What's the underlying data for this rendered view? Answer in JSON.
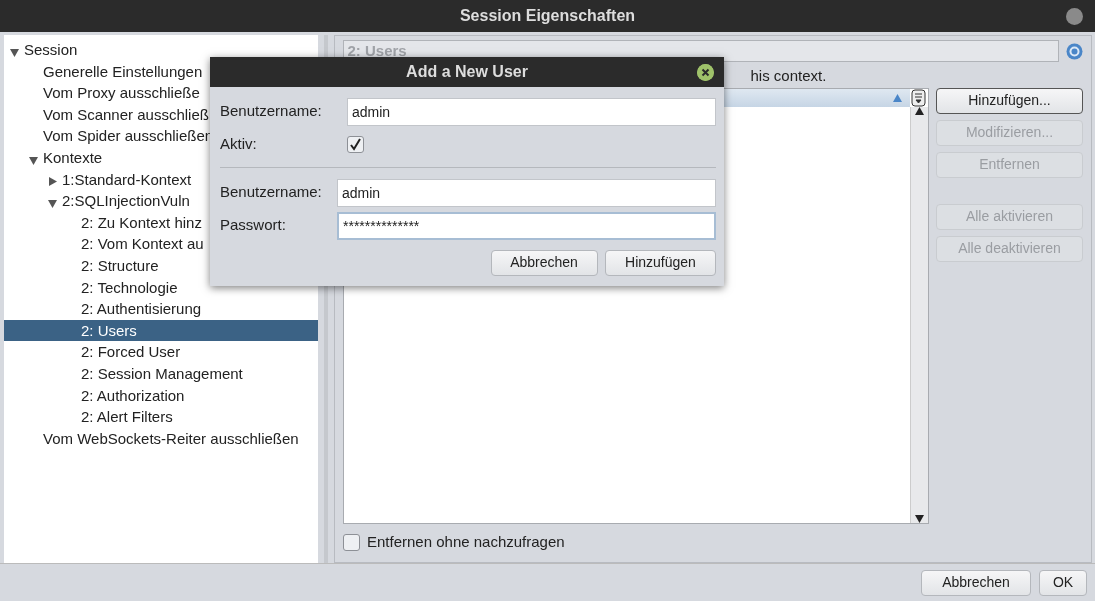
{
  "window": {
    "title": "Session Eigenschaften"
  },
  "tree": [
    {
      "label": "Session",
      "expanded": true,
      "selected": false,
      "children": [
        {
          "label": "Generelle Einstellungen",
          "selected": false
        },
        {
          "label": "Vom Proxy ausschließe",
          "selected": false
        },
        {
          "label": "Vom Scanner ausschließ",
          "selected": false
        },
        {
          "label": "Vom Spider ausschließen",
          "selected": false
        },
        {
          "label": "Kontexte",
          "expanded": true,
          "selected": false,
          "children": [
            {
              "label": "1:Standard-Kontext",
              "expanded": false,
              "selected": false
            },
            {
              "label": "2:SQLInjectionVuln",
              "expanded": true,
              "selected": false,
              "children": [
                {
                  "label": "2: Zu Kontext hinz",
                  "selected": false
                },
                {
                  "label": "2: Vom Kontext au",
                  "selected": false
                },
                {
                  "label": "2: Structure",
                  "selected": false
                },
                {
                  "label": "2: Technologie",
                  "selected": false
                },
                {
                  "label": "2: Authentisierung",
                  "selected": false
                },
                {
                  "label": "2: Users",
                  "selected": true
                },
                {
                  "label": "2: Forced User",
                  "selected": false
                },
                {
                  "label": "2: Session Management",
                  "selected": false
                },
                {
                  "label": "2: Authorization",
                  "selected": false
                },
                {
                  "label": "2: Alert Filters",
                  "selected": false
                }
              ]
            }
          ]
        },
        {
          "label": "Vom WebSockets-Reiter ausschließen",
          "selected": false
        }
      ]
    }
  ],
  "panel": {
    "title": "2: Users",
    "description": "his context.",
    "buttons": [
      {
        "label": "Hinzufügen...",
        "disabled": false
      },
      {
        "label": "Modifizieren...",
        "disabled": true
      },
      {
        "label": "Entfernen",
        "disabled": true
      },
      {
        "label": "Alle aktivieren",
        "disabled": true
      },
      {
        "label": "Alle deaktivieren",
        "disabled": true
      }
    ],
    "checkbox": {
      "label": "Entfernen ohne nachzufragen",
      "checked": false
    }
  },
  "footer_buttons": [
    "Abbrechen",
    "OK"
  ],
  "dialog": {
    "title": "Add a New User",
    "fields": [
      {
        "kind": "text",
        "label": "Benutzername:",
        "value": "admin"
      },
      {
        "kind": "checkbox",
        "label": "Aktiv:",
        "checked": true
      },
      {
        "kind": "separator"
      },
      {
        "kind": "text",
        "label": "Benutzername:",
        "value": "admin"
      },
      {
        "kind": "password",
        "label": "Passwort:",
        "value": "**************"
      }
    ],
    "buttons": [
      "Abbrechen",
      "Hinzufügen"
    ]
  }
}
